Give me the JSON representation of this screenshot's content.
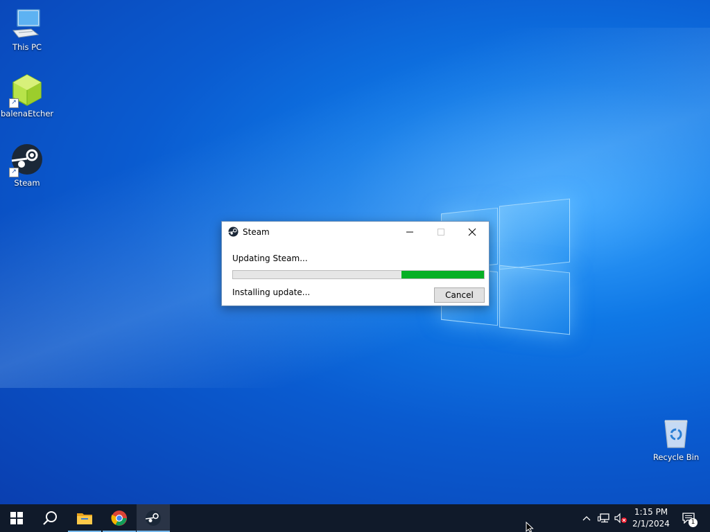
{
  "desktop": {
    "icons": [
      {
        "label": "This PC",
        "icon": "this-pc-icon"
      },
      {
        "label": "balenaEtcher",
        "icon": "balena-etcher-icon"
      },
      {
        "label": "Steam",
        "icon": "steam-icon"
      },
      {
        "label": "Recycle Bin",
        "icon": "recycle-bin-icon"
      }
    ]
  },
  "dialog": {
    "title": "Steam",
    "status_text": "Updating Steam...",
    "progress_fraction": 0.33,
    "progress_color": "#06b025",
    "detail_text": "Installing update...",
    "cancel_label": "Cancel"
  },
  "taskbar": {
    "items": [
      "start-icon",
      "search-icon",
      "file-explorer-icon",
      "chrome-icon",
      "steam-icon"
    ],
    "active_item": "steam-icon",
    "clock_time": "1:15 PM",
    "clock_date": "2/1/2024",
    "notification_count": "1"
  },
  "colors": {
    "desktop_accent": "#0f78e6",
    "taskbar": "#101a2a",
    "progress_fill": "#06b025"
  }
}
